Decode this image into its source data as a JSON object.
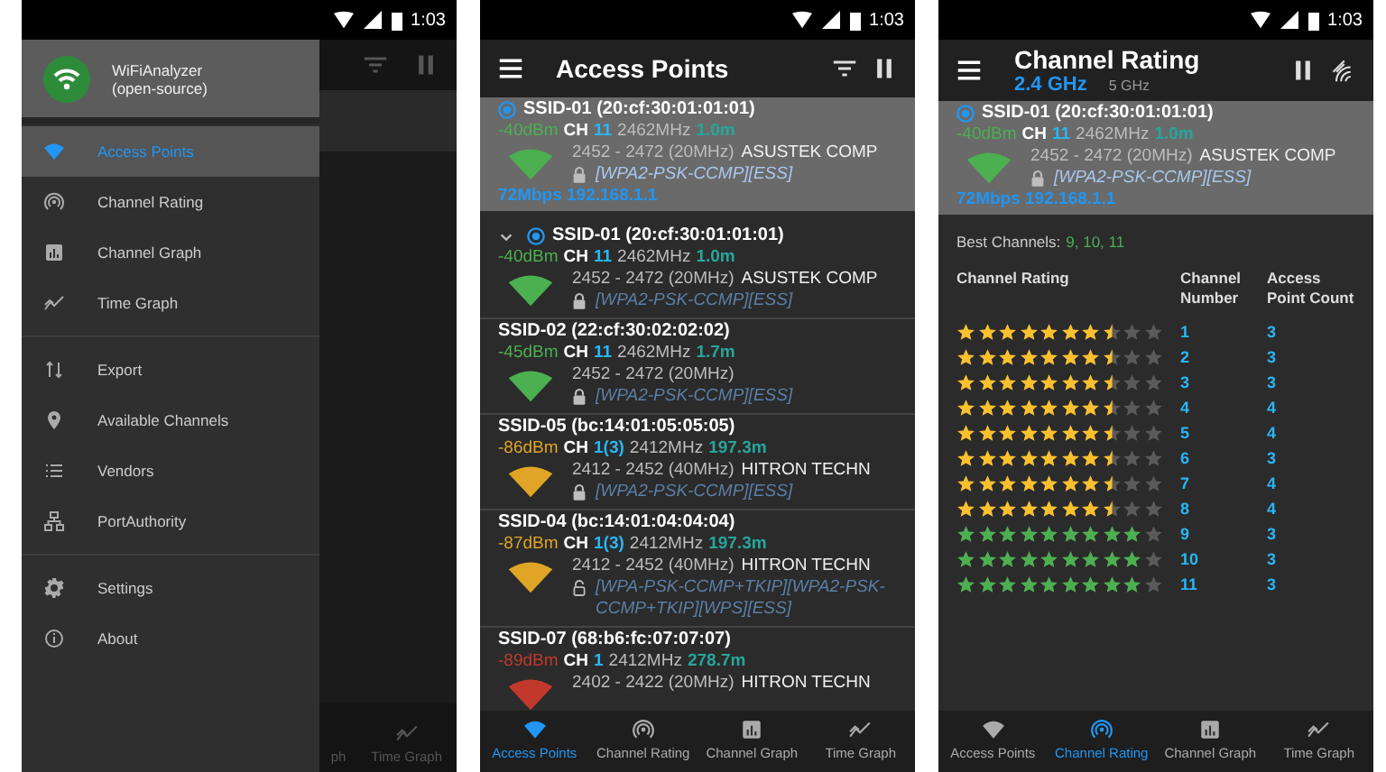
{
  "phones": [
    {
      "kind": "drawer",
      "status_bar": {
        "time": "1:03"
      },
      "drawer": {
        "title": "WiFiAnalyzer",
        "subtitle": "(open-source)",
        "groups": [
          {
            "items": [
              {
                "label": "Access Points",
                "kind": "wifi",
                "selected": true
              },
              {
                "label": "Channel Rating",
                "kind": "rating",
                "selected": false
              },
              {
                "label": "Channel Graph",
                "kind": "graph",
                "selected": false
              },
              {
                "label": "Time Graph",
                "kind": "time_graph",
                "selected": false
              }
            ]
          },
          {
            "items": [
              {
                "label": "Export",
                "kind": "export",
                "selected": false
              },
              {
                "label": "Available Channels",
                "kind": "pin",
                "selected": false
              },
              {
                "label": "Vendors",
                "kind": "list",
                "selected": false
              },
              {
                "label": "PortAuthority",
                "kind": "network",
                "selected": false
              }
            ]
          },
          {
            "items": [
              {
                "label": "Settings",
                "kind": "gear",
                "selected": false
              },
              {
                "label": "About",
                "kind": "info",
                "selected": false
              }
            ]
          }
        ]
      },
      "background_nav": [
        {
          "label": "ph",
          "kind": "none"
        },
        {
          "label": "Time Graph",
          "kind": "time_graph"
        }
      ]
    },
    {
      "kind": "access_points",
      "status_bar": {
        "time": "1:03"
      },
      "toolbar": {
        "title": "Access Points"
      },
      "connected": {
        "ssid": "SSID-01 (20:cf:30:01:01:01)",
        "dbm": "-40dBm",
        "color": "#4caf50",
        "channel_label": "CH",
        "channel": "11",
        "frequency": "2462MHz",
        "distance": "1.0m",
        "range": "2452 - 2472 (20MHz)",
        "vendor": "ASUSTEK COMP",
        "security": "[WPA2-PSK-CCMP][ESS]",
        "locked": true,
        "speed": "72Mbps",
        "ip": "192.168.1.1"
      },
      "access_points": [
        {
          "ssid": "SSID-01 (20:cf:30:01:01:01)",
          "expanded": true,
          "connected": true,
          "dbm": "-40dBm",
          "color": "#4caf50",
          "channel_label": "CH",
          "channel": "11",
          "frequency": "2462MHz",
          "distance": "1.0m",
          "range": "2452 - 2472 (20MHz)",
          "vendor": "ASUSTEK COMP",
          "security": "[WPA2-PSK-CCMP][ESS]",
          "locked": true
        },
        {
          "ssid": "SSID-02 (22:cf:30:02:02:02)",
          "connected": false,
          "dbm": "-45dBm",
          "color": "#4caf50",
          "channel_label": "CH",
          "channel": "11",
          "frequency": "2462MHz",
          "distance": "1.7m",
          "range": "2452 - 2472 (20MHz)",
          "security": "[WPA2-PSK-CCMP][ESS]",
          "locked": true
        },
        {
          "ssid": "SSID-05 (bc:14:01:05:05:05)",
          "connected": false,
          "dbm": "-86dBm",
          "color": "#e0a526",
          "channel_label": "CH",
          "channel": "1(3)",
          "frequency": "2412MHz",
          "distance": "197.3m",
          "range": "2412 - 2452 (40MHz)",
          "vendor": "HITRON TECHN",
          "security": "[WPA2-PSK-CCMP][ESS]",
          "locked": true
        },
        {
          "ssid": "SSID-04 (bc:14:01:04:04:04)",
          "connected": false,
          "dbm": "-87dBm",
          "color": "#e0a526",
          "channel_label": "CH",
          "channel": "1(3)",
          "frequency": "2412MHz",
          "distance": "197.3m",
          "range": "2412 - 2452 (40MHz)",
          "vendor": "HITRON TECHN",
          "security": "[WPA-PSK-CCMP+TKIP][WPA2-PSK-CCMP+TKIP][WPS][ESS]",
          "locked": false
        },
        {
          "ssid": "SSID-07 (68:b6:fc:07:07:07)",
          "connected": false,
          "dbm": "-89dBm",
          "color": "#c0392b",
          "channel_label": "CH",
          "channel": "1",
          "frequency": "2412MHz",
          "distance": "278.7m",
          "range": "2402 - 2422 (20MHz)",
          "vendor": "HITRON TECHN"
        }
      ],
      "bottom_nav": [
        {
          "label": "Access Points",
          "kind": "wifi",
          "selected": true
        },
        {
          "label": "Channel Rating",
          "kind": "rating",
          "selected": false
        },
        {
          "label": "Channel Graph",
          "kind": "graph",
          "selected": false
        },
        {
          "label": "Time Graph",
          "kind": "time_graph",
          "selected": false
        }
      ]
    },
    {
      "kind": "channel_rating",
      "status_bar": {
        "time": "1:03"
      },
      "toolbar": {
        "title": "Channel Rating",
        "bands": [
          {
            "label": "2.4 GHz",
            "selected": true
          },
          {
            "label": "5 GHz",
            "selected": false
          }
        ]
      },
      "connected": {
        "ssid": "SSID-01 (20:cf:30:01:01:01)",
        "dbm": "-40dBm",
        "color": "#4caf50",
        "channel_label": "CH",
        "channel": "11",
        "frequency": "2462MHz",
        "distance": "1.0m",
        "range": "2452 - 2472 (20MHz)",
        "vendor": "ASUSTEK COMP",
        "security": "[WPA2-PSK-CCMP][ESS]",
        "locked": true,
        "speed": "72Mbps",
        "ip": "192.168.1.1"
      },
      "best_channels": {
        "label": "Best Channels:",
        "value": "9, 10, 11"
      },
      "rating_table": {
        "columns": [
          "Channel Rating",
          "Channel Number",
          "Access Point Count"
        ],
        "rows": [
          {
            "stars": 7.5,
            "channel": "1",
            "count": "3"
          },
          {
            "stars": 7.5,
            "channel": "2",
            "count": "3"
          },
          {
            "stars": 7.5,
            "channel": "3",
            "count": "3"
          },
          {
            "stars": 7.5,
            "channel": "4",
            "count": "4"
          },
          {
            "stars": 7.5,
            "channel": "5",
            "count": "4"
          },
          {
            "stars": 7.5,
            "channel": "6",
            "count": "3"
          },
          {
            "stars": 7.5,
            "channel": "7",
            "count": "4"
          },
          {
            "stars": 7.5,
            "channel": "8",
            "count": "4"
          },
          {
            "stars": 9,
            "channel": "9",
            "count": "3"
          },
          {
            "stars": 9,
            "channel": "10",
            "count": "3"
          },
          {
            "stars": 9,
            "channel": "11",
            "count": "3"
          }
        ]
      },
      "bottom_nav": [
        {
          "label": "Access Points",
          "kind": "wifi",
          "selected": false
        },
        {
          "label": "Channel Rating",
          "kind": "rating",
          "selected": true
        },
        {
          "label": "Channel Graph",
          "kind": "graph",
          "selected": false
        },
        {
          "label": "Time Graph",
          "kind": "time_graph",
          "selected": false
        }
      ]
    }
  ]
}
